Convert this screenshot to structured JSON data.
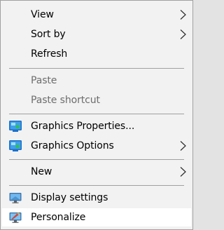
{
  "menu": {
    "items": [
      {
        "label": "View"
      },
      {
        "label": "Sort by"
      },
      {
        "label": "Refresh"
      },
      {
        "label": "Paste"
      },
      {
        "label": "Paste shortcut"
      },
      {
        "label": "Graphics Properties..."
      },
      {
        "label": "Graphics Options"
      },
      {
        "label": "New"
      },
      {
        "label": "Display settings"
      },
      {
        "label": "Personalize"
      }
    ],
    "icons": {
      "submenu_arrow": "chevron-right-icon",
      "graphics_properties": "intel-graphics-icon",
      "graphics_options": "intel-graphics-icon",
      "display_settings": "monitor-icon",
      "personalize": "personalize-monitor-icon"
    },
    "colors": {
      "background": "#f2f2f2",
      "hover_background": "#ffffff",
      "border": "#a0a0a0",
      "disabled_text": "#6d6d6d"
    }
  }
}
